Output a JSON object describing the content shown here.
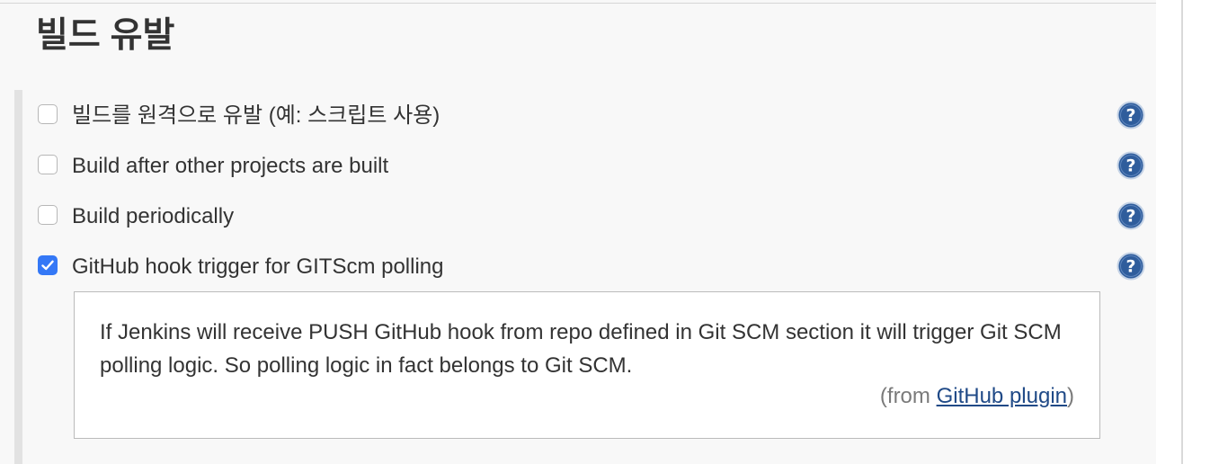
{
  "section": {
    "title": "빌드 유발"
  },
  "triggers": [
    {
      "label": "빌드를 원격으로 유발 (예: 스크립트 사용)",
      "checked": false,
      "help_icon": "help-icon"
    },
    {
      "label": "Build after other projects are built",
      "checked": false,
      "help_icon": "help-icon"
    },
    {
      "label": "Build periodically",
      "checked": false,
      "help_icon": "help-icon"
    },
    {
      "label": "GitHub hook trigger for GITScm polling",
      "checked": true,
      "help_icon": "help-icon"
    }
  ],
  "help": {
    "text": "If Jenkins will receive PUSH GitHub hook from repo defined in Git SCM section it will trigger Git SCM polling logic. So polling logic in fact belongs to Git SCM.",
    "from_prefix": "(from ",
    "link_label": "GitHub plugin",
    "from_suffix": ")"
  },
  "colors": {
    "checkbox_checked": "#3478f6",
    "help_icon_fill": "#2f5d9c",
    "link": "#204a87"
  }
}
